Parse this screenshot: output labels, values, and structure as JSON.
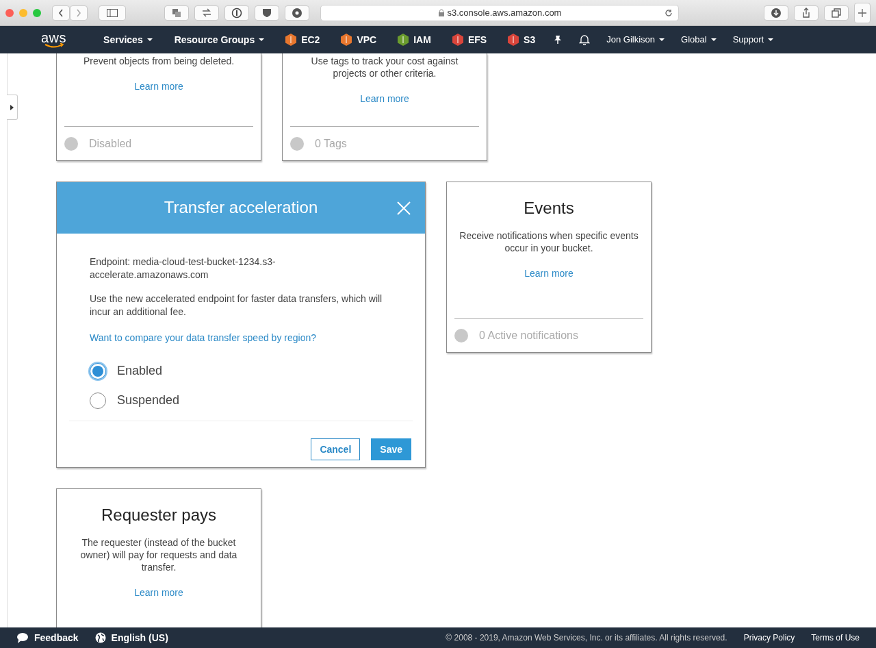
{
  "browser": {
    "address": "s3.console.aws.amazon.com"
  },
  "nav": {
    "logo": "aws",
    "items": [
      {
        "label": "Services",
        "kind": "menu"
      },
      {
        "label": "Resource Groups",
        "kind": "menu"
      },
      {
        "label": "EC2",
        "kind": "service",
        "color": "#e8772e"
      },
      {
        "label": "VPC",
        "kind": "service",
        "color": "#e8772e"
      },
      {
        "label": "IAM",
        "kind": "service",
        "color": "#6b9c2e"
      },
      {
        "label": "EFS",
        "kind": "service",
        "color": "#d9453b"
      },
      {
        "label": "S3",
        "kind": "service",
        "color": "#d9453b"
      },
      {
        "kind": "pin"
      },
      {
        "kind": "bell"
      },
      {
        "label": "Jon Gilkison",
        "kind": "dropdown"
      },
      {
        "label": "Global",
        "kind": "dropdown"
      },
      {
        "label": "Support",
        "kind": "dropdown"
      }
    ]
  },
  "rows": [
    [
      {
        "kind": "property",
        "description": "Prevent objects from being deleted.",
        "link": "Learn more",
        "status": "Disabled"
      },
      {
        "kind": "property",
        "description": "Use tags to track your cost against projects or other criteria.",
        "link": "Learn more",
        "status": "0 Tags"
      }
    ],
    [
      {
        "kind": "editor",
        "title": "Transfer acceleration",
        "endpoint": "Endpoint: media-cloud-test-bucket-1234.s3-accelerate.amazonaws.com",
        "description": "Use the new accelerated endpoint for faster data transfers, which will incur an additional fee.",
        "link": "Want to compare your data transfer speed by region?",
        "options": [
          {
            "label": "Enabled",
            "selected": true
          },
          {
            "label": "Suspended",
            "selected": false
          }
        ],
        "buttons": [
          {
            "label": "Cancel",
            "kind": "secondary"
          },
          {
            "label": "Save",
            "kind": "primary"
          }
        ]
      },
      {
        "kind": "property",
        "title": "Events",
        "description": "Receive notifications when specific events occur in your bucket.",
        "link": "Learn more",
        "status": "0 Active notifications"
      }
    ],
    [
      {
        "kind": "property",
        "title": "Requester pays",
        "description": "The requester (instead of the bucket owner) will pay for requests and data transfer.",
        "link": "Learn more"
      }
    ]
  ],
  "footer": {
    "feedback": "Feedback",
    "language": "English (US)",
    "copyright": "© 2008 - 2019, Amazon Web Services, Inc. or its affiliates. All rights reserved.",
    "links": [
      "Privacy Policy",
      "Terms of Use"
    ]
  }
}
